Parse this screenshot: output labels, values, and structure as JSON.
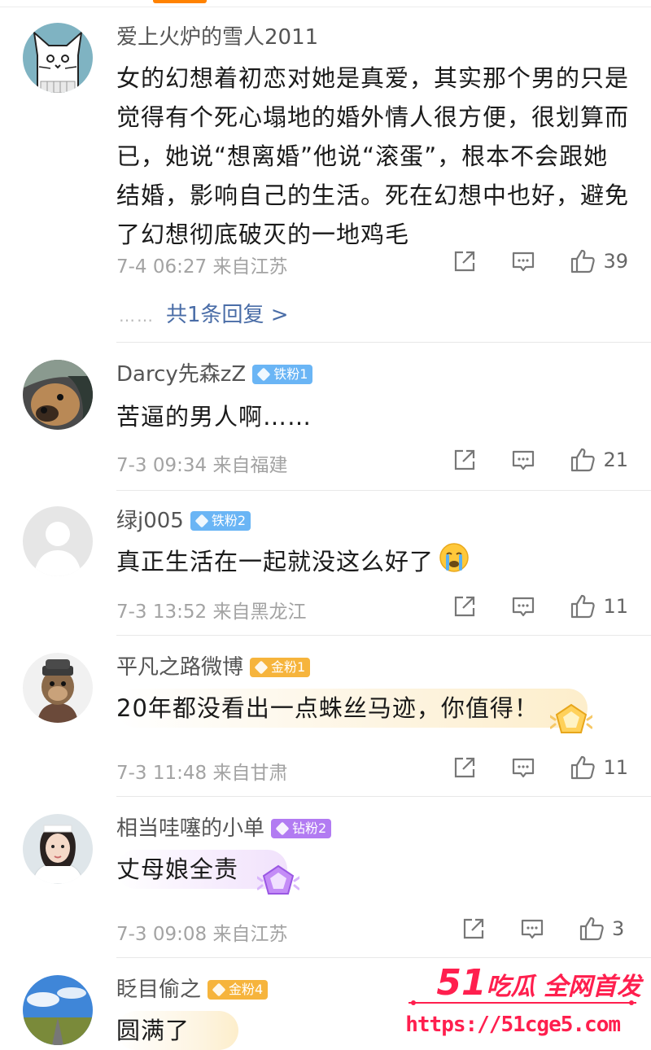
{
  "colors": {
    "accent": "#ff8200",
    "reply_link": "#4a6da7",
    "meta_text": "#a3a3a3",
    "badge_tie": "#6ab5f5",
    "badge_jin": "#f6b43c",
    "badge_zuan": "#b27bf2",
    "watermark": "#ff1f4e"
  },
  "comments": [
    {
      "username": "爱上火炉的雪人2011",
      "badge": "",
      "text": "女的幻想着初恋对她是真爱，其实那个男的只是觉得有个死心塌地的婚外情人很方便，很划算而已，她说“想离婚”他说“滚蛋”，根本不会跟她结婚，影响自己的生活。死在幻想中也好，避免了幻想彻底破灭的一地鸡毛",
      "time": "7-4 06:27",
      "location": "来自江苏",
      "likes": "39",
      "reply_dots": "……",
      "reply_link": "共1条回复 >",
      "avatar_icon": "cat-avatar-icon"
    },
    {
      "username": "Darcy先森zZ",
      "badge": "铁粉1",
      "text": "苦逼的男人啊……",
      "time": "7-3 09:34",
      "location": "来自福建",
      "likes": "21",
      "avatar_icon": "dog-avatar-icon"
    },
    {
      "username": "绿j005",
      "badge": "铁粉2",
      "text": "真正生活在一起就没这么好了",
      "emoji": "crying-face-emoji",
      "time": "7-3 13:52",
      "location": "来自黑龙江",
      "likes": "11",
      "avatar_icon": "default-avatar-icon"
    },
    {
      "username": "平凡之路微博",
      "badge": "金粉1",
      "text": "20年都没看出一点蛛丝马迹，你值得！",
      "time": "7-3 11:48",
      "location": "来自甘肃",
      "likes": "11",
      "avatar_icon": "monkey-avatar-icon"
    },
    {
      "username": "相当哇噻的小单",
      "badge": "钻粉2",
      "text": "丈母娘全责",
      "time": "7-3 09:08",
      "location": "来自江苏",
      "likes": "3",
      "avatar_icon": "nurse-avatar-icon"
    },
    {
      "username": "眨目偷之",
      "badge": "金粉4",
      "text": "圆满了",
      "avatar_icon": "landscape-avatar-icon"
    }
  ],
  "watermark": {
    "brand": "51吃瓜 全网首发",
    "brand_num": "51",
    "brand_text": "吃瓜 全网首发",
    "url": "https://51cge5.com"
  }
}
